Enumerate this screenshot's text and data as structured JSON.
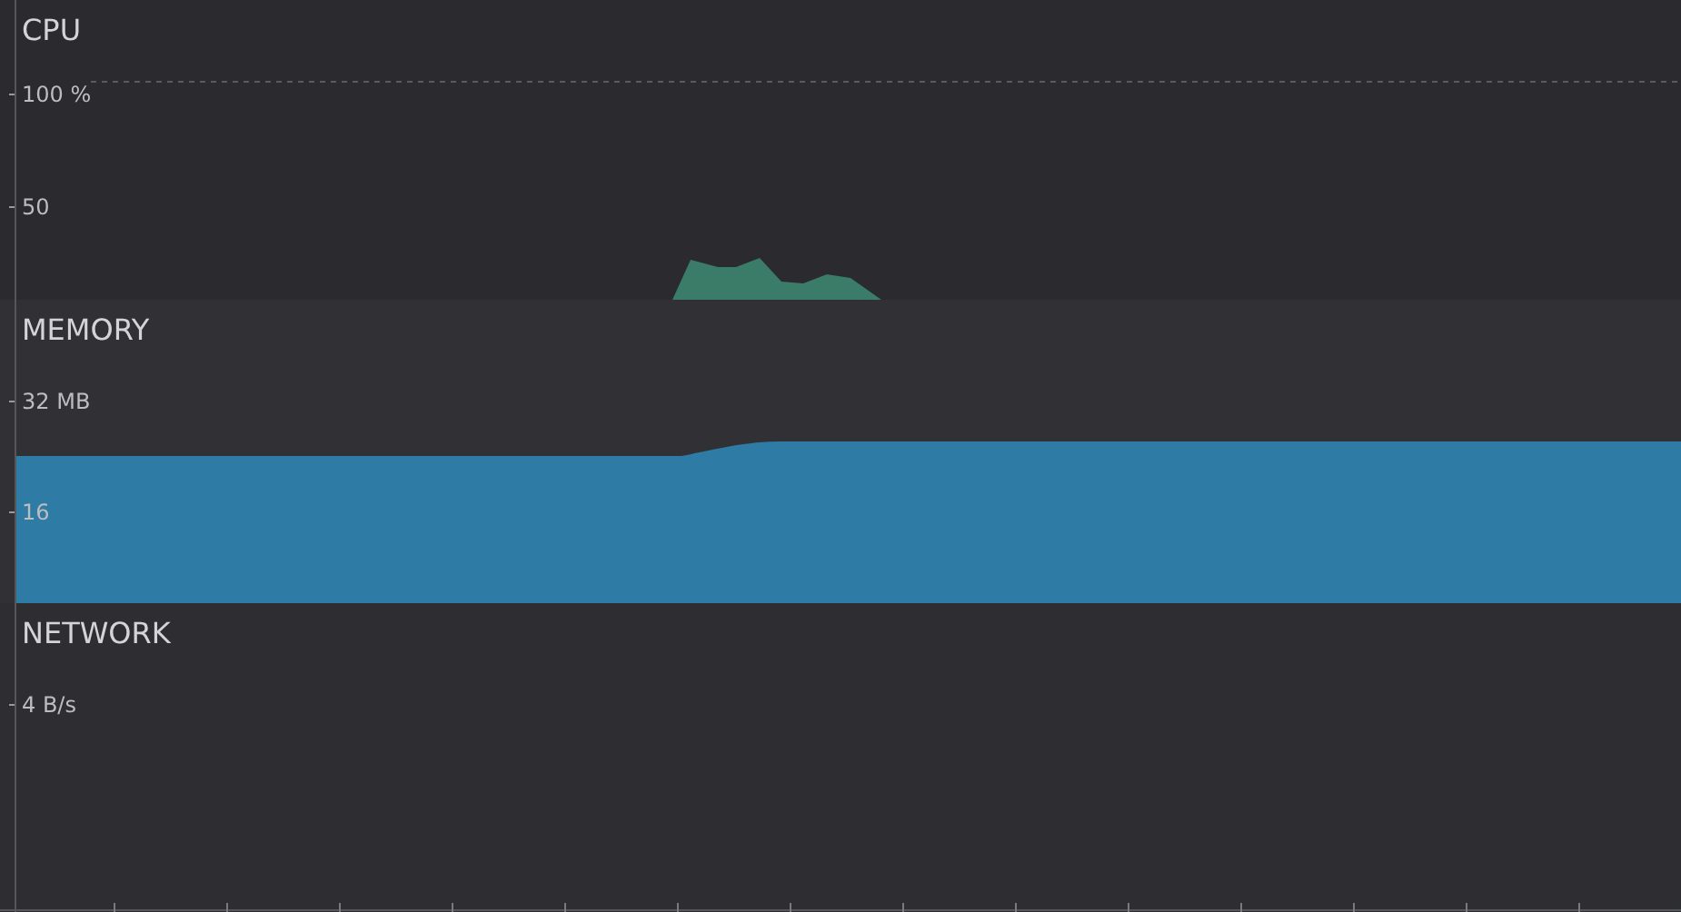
{
  "panels": [
    {
      "kind": "cpu",
      "title": "CPU",
      "axis_labels": [
        "100 %",
        "50"
      ]
    },
    {
      "kind": "memory",
      "title": "MEMORY",
      "axis_labels": [
        "32 MB",
        "16"
      ]
    },
    {
      "kind": "network",
      "title": "NETWORK",
      "axis_labels": [
        "4 B/s"
      ]
    }
  ]
}
